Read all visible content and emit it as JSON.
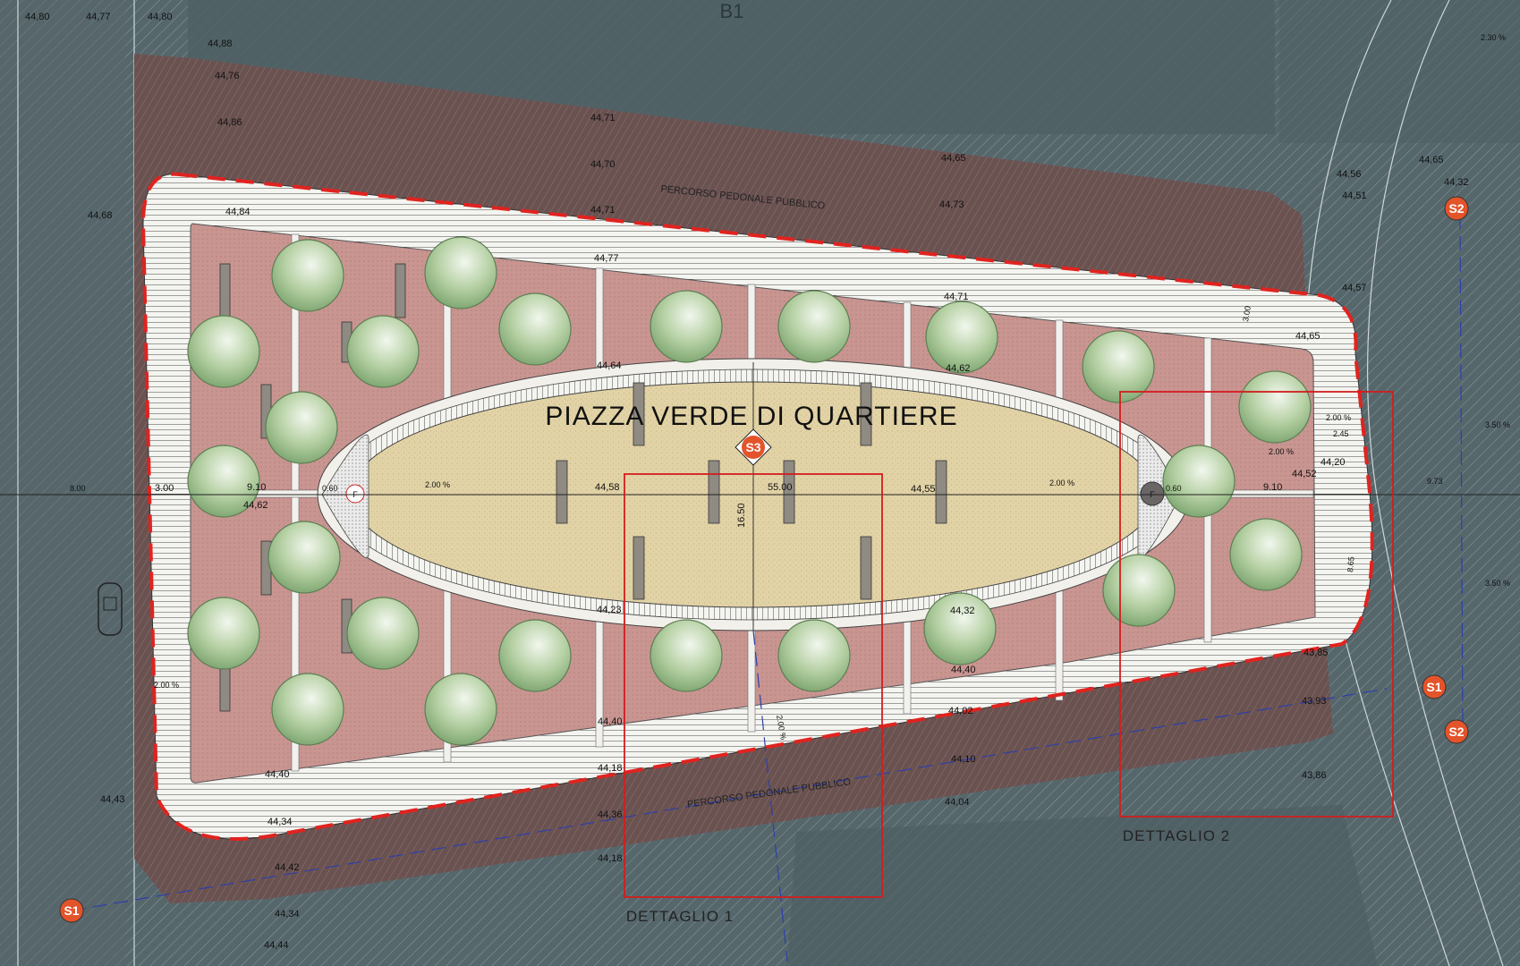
{
  "title": "PIAZZA VERDE DI QUARTIERE",
  "block_label": "B1",
  "path_labels": [
    "PERCORSO PEDONALE PUBBLICO",
    "PERCORSO PEDONALE PUBBLICO"
  ],
  "details": [
    "DETTAGLIO 1",
    "DETTAGLIO 2"
  ],
  "sections": {
    "s1": "S1",
    "s2": "S2",
    "s3": "S3"
  },
  "fountains": [
    "F",
    "F"
  ],
  "dimensions": {
    "central_length": "55.00",
    "central_width": "16.50",
    "left_width": "9.10",
    "right_width": "9.10",
    "left_offset": "3.00",
    "right_offset": "9.73",
    "left_edge": "8.00",
    "side_3": "3.00",
    "side_9": "8.65",
    "small_1": "0.60",
    "small_2": "0.60",
    "angled": "2.45"
  },
  "slopes": [
    "2.00 %",
    "2.00 %",
    "2.00 %",
    "2.00 %",
    "2.00 %",
    "2.00 %",
    "3.50 %",
    "3.50 %",
    "2.30 %"
  ],
  "elevations": {
    "top_left_1": "44,80",
    "top_left_2": "44,77",
    "top_left_3": "44,80",
    "top_a": "44,88",
    "top_b": "44,76",
    "top_c": "44,84",
    "top_d": "44,86",
    "top_e": "44,77",
    "top_f": "44,71",
    "top_g": "44,70",
    "top_h": "44,71",
    "top_i": "44,73",
    "top_j": "44,65",
    "top_k": "44,71",
    "top_l": "44,65",
    "top_m": "44,56",
    "top_n": "44,51",
    "top_o": "44,57",
    "top_p": "44,65",
    "right_a": "44,32",
    "right_b": "44,20",
    "right_c": "44,52",
    "mid_a": "44,64",
    "mid_b": "44,62",
    "mid_c": "44,58",
    "mid_d": "44,55",
    "mid_e": "44,62",
    "mid_f": "44,23",
    "mid_g": "44,32",
    "mid_h": "44,68",
    "bot_a": "44,40",
    "bot_b": "44,40",
    "bot_c": "44,02",
    "bot_d": "44,40",
    "bot_e": "44,18",
    "bot_f": "44,34",
    "bot_g": "44,43",
    "bot_h": "43,85",
    "bot_i": "43,93",
    "bot_j": "44,10",
    "bot_k": "44,04",
    "bot_l": "44,36",
    "bot_m": "44,42",
    "bot_n": "44,34",
    "bot_o": "44,18",
    "bot_p": "44,44",
    "bot_q": "43,86"
  }
}
